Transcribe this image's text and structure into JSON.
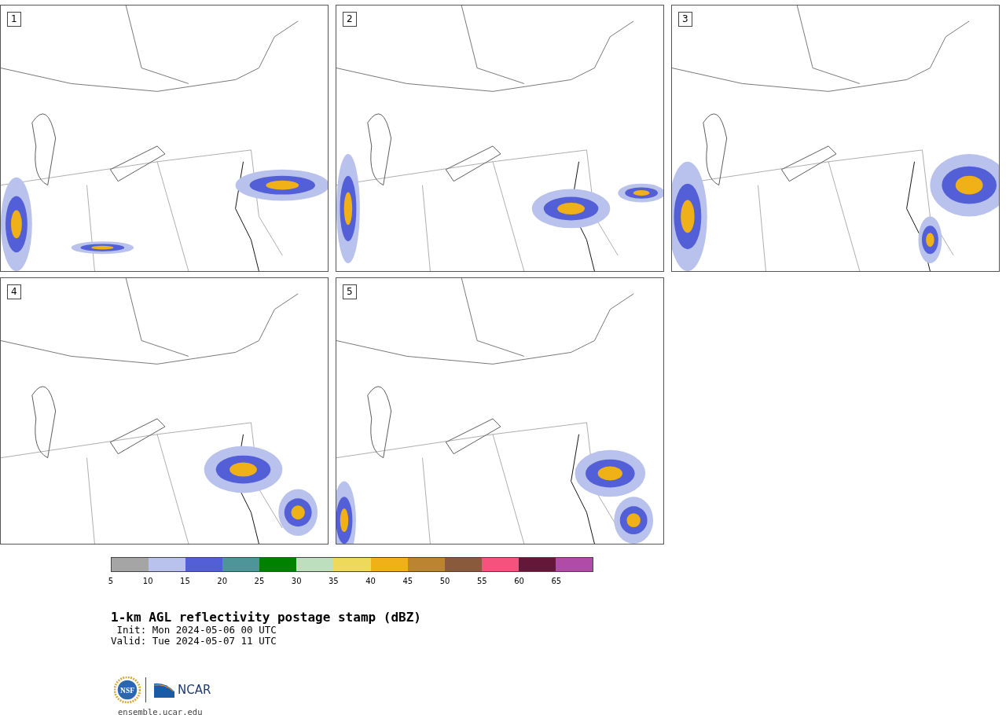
{
  "panels": [
    {
      "label": "1"
    },
    {
      "label": "2"
    },
    {
      "label": "3"
    },
    {
      "label": "4"
    },
    {
      "label": "5"
    }
  ],
  "colorbar": {
    "bins": [
      {
        "color": "#a5a5a5"
      },
      {
        "color": "#b8c2ec"
      },
      {
        "color": "#535fd6"
      },
      {
        "color": "#4e9599"
      },
      {
        "color": "#008200"
      },
      {
        "color": "#bedfbd"
      },
      {
        "color": "#efd95a"
      },
      {
        "color": "#efb018"
      },
      {
        "color": "#bb8431"
      },
      {
        "color": "#8a5a3d"
      },
      {
        "color": "#f5527d"
      },
      {
        "color": "#641739"
      },
      {
        "color": "#b04ca8"
      }
    ],
    "ticks": [
      "5",
      "10",
      "15",
      "20",
      "25",
      "30",
      "35",
      "40",
      "45",
      "50",
      "55",
      "60",
      "65"
    ]
  },
  "title": "1-km AGL reflectivity postage stamp (dBZ)",
  "init": " Init: Mon 2024-05-06 00 UTC",
  "valid": "Valid: Tue 2024-05-07 11 UTC",
  "logos": {
    "left": "NSF",
    "right": "NCAR"
  },
  "site": "ensemble.ucar.edu"
}
